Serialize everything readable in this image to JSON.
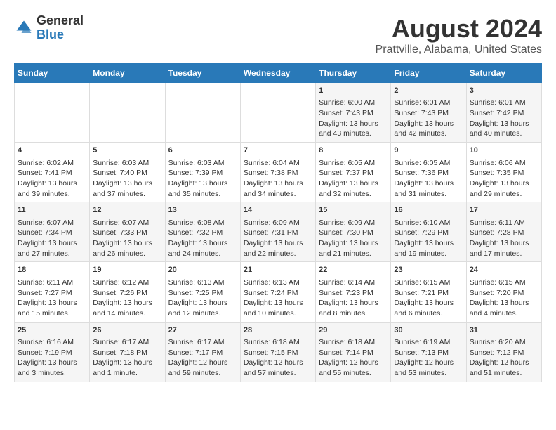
{
  "header": {
    "logo_general": "General",
    "logo_blue": "Blue",
    "title": "August 2024",
    "subtitle": "Prattville, Alabama, United States"
  },
  "days_of_week": [
    "Sunday",
    "Monday",
    "Tuesday",
    "Wednesday",
    "Thursday",
    "Friday",
    "Saturday"
  ],
  "weeks": [
    [
      {
        "day": "",
        "content": ""
      },
      {
        "day": "",
        "content": ""
      },
      {
        "day": "",
        "content": ""
      },
      {
        "day": "",
        "content": ""
      },
      {
        "day": "1",
        "content": "Sunrise: 6:00 AM\nSunset: 7:43 PM\nDaylight: 13 hours\nand 43 minutes."
      },
      {
        "day": "2",
        "content": "Sunrise: 6:01 AM\nSunset: 7:43 PM\nDaylight: 13 hours\nand 42 minutes."
      },
      {
        "day": "3",
        "content": "Sunrise: 6:01 AM\nSunset: 7:42 PM\nDaylight: 13 hours\nand 40 minutes."
      }
    ],
    [
      {
        "day": "4",
        "content": "Sunrise: 6:02 AM\nSunset: 7:41 PM\nDaylight: 13 hours\nand 39 minutes."
      },
      {
        "day": "5",
        "content": "Sunrise: 6:03 AM\nSunset: 7:40 PM\nDaylight: 13 hours\nand 37 minutes."
      },
      {
        "day": "6",
        "content": "Sunrise: 6:03 AM\nSunset: 7:39 PM\nDaylight: 13 hours\nand 35 minutes."
      },
      {
        "day": "7",
        "content": "Sunrise: 6:04 AM\nSunset: 7:38 PM\nDaylight: 13 hours\nand 34 minutes."
      },
      {
        "day": "8",
        "content": "Sunrise: 6:05 AM\nSunset: 7:37 PM\nDaylight: 13 hours\nand 32 minutes."
      },
      {
        "day": "9",
        "content": "Sunrise: 6:05 AM\nSunset: 7:36 PM\nDaylight: 13 hours\nand 31 minutes."
      },
      {
        "day": "10",
        "content": "Sunrise: 6:06 AM\nSunset: 7:35 PM\nDaylight: 13 hours\nand 29 minutes."
      }
    ],
    [
      {
        "day": "11",
        "content": "Sunrise: 6:07 AM\nSunset: 7:34 PM\nDaylight: 13 hours\nand 27 minutes."
      },
      {
        "day": "12",
        "content": "Sunrise: 6:07 AM\nSunset: 7:33 PM\nDaylight: 13 hours\nand 26 minutes."
      },
      {
        "day": "13",
        "content": "Sunrise: 6:08 AM\nSunset: 7:32 PM\nDaylight: 13 hours\nand 24 minutes."
      },
      {
        "day": "14",
        "content": "Sunrise: 6:09 AM\nSunset: 7:31 PM\nDaylight: 13 hours\nand 22 minutes."
      },
      {
        "day": "15",
        "content": "Sunrise: 6:09 AM\nSunset: 7:30 PM\nDaylight: 13 hours\nand 21 minutes."
      },
      {
        "day": "16",
        "content": "Sunrise: 6:10 AM\nSunset: 7:29 PM\nDaylight: 13 hours\nand 19 minutes."
      },
      {
        "day": "17",
        "content": "Sunrise: 6:11 AM\nSunset: 7:28 PM\nDaylight: 13 hours\nand 17 minutes."
      }
    ],
    [
      {
        "day": "18",
        "content": "Sunrise: 6:11 AM\nSunset: 7:27 PM\nDaylight: 13 hours\nand 15 minutes."
      },
      {
        "day": "19",
        "content": "Sunrise: 6:12 AM\nSunset: 7:26 PM\nDaylight: 13 hours\nand 14 minutes."
      },
      {
        "day": "20",
        "content": "Sunrise: 6:13 AM\nSunset: 7:25 PM\nDaylight: 13 hours\nand 12 minutes."
      },
      {
        "day": "21",
        "content": "Sunrise: 6:13 AM\nSunset: 7:24 PM\nDaylight: 13 hours\nand 10 minutes."
      },
      {
        "day": "22",
        "content": "Sunrise: 6:14 AM\nSunset: 7:23 PM\nDaylight: 13 hours\nand 8 minutes."
      },
      {
        "day": "23",
        "content": "Sunrise: 6:15 AM\nSunset: 7:21 PM\nDaylight: 13 hours\nand 6 minutes."
      },
      {
        "day": "24",
        "content": "Sunrise: 6:15 AM\nSunset: 7:20 PM\nDaylight: 13 hours\nand 4 minutes."
      }
    ],
    [
      {
        "day": "25",
        "content": "Sunrise: 6:16 AM\nSunset: 7:19 PM\nDaylight: 13 hours\nand 3 minutes."
      },
      {
        "day": "26",
        "content": "Sunrise: 6:17 AM\nSunset: 7:18 PM\nDaylight: 13 hours\nand 1 minute."
      },
      {
        "day": "27",
        "content": "Sunrise: 6:17 AM\nSunset: 7:17 PM\nDaylight: 12 hours\nand 59 minutes."
      },
      {
        "day": "28",
        "content": "Sunrise: 6:18 AM\nSunset: 7:15 PM\nDaylight: 12 hours\nand 57 minutes."
      },
      {
        "day": "29",
        "content": "Sunrise: 6:18 AM\nSunset: 7:14 PM\nDaylight: 12 hours\nand 55 minutes."
      },
      {
        "day": "30",
        "content": "Sunrise: 6:19 AM\nSunset: 7:13 PM\nDaylight: 12 hours\nand 53 minutes."
      },
      {
        "day": "31",
        "content": "Sunrise: 6:20 AM\nSunset: 7:12 PM\nDaylight: 12 hours\nand 51 minutes."
      }
    ]
  ]
}
